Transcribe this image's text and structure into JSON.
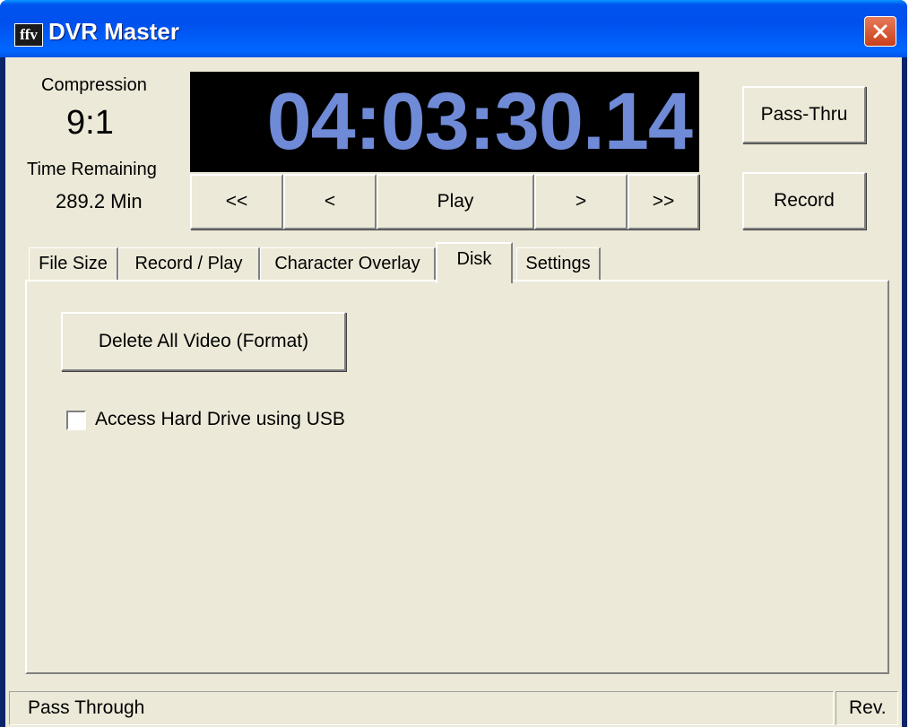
{
  "window": {
    "title": "DVR Master",
    "app_icon_text": "ffv",
    "icons": {
      "app": "app-logo-icon",
      "close": "close-icon"
    },
    "colors": {
      "timecode_text": "#6f8ad6",
      "timecode_bg": "#000000",
      "close_button": "#d9532c"
    }
  },
  "info": {
    "compression_label": "Compression",
    "compression_value": "9:1",
    "time_remaining_label": "Time Remaining",
    "time_remaining_value": "289.2 Min"
  },
  "timecode": "04:03:30.14",
  "transport": {
    "rewind_fast": "<<",
    "rewind": "<",
    "play": "Play",
    "forward": ">",
    "forward_fast": ">>"
  },
  "buttons": {
    "pass_thru": "Pass-Thru",
    "record": "Record"
  },
  "tabs": [
    {
      "label": "File Size",
      "active": false
    },
    {
      "label": "Record / Play",
      "active": false
    },
    {
      "label": "Character Overlay",
      "active": false
    },
    {
      "label": "Disk",
      "active": true
    },
    {
      "label": "Settings",
      "active": false
    }
  ],
  "disk": {
    "format_button": "Delete All Video (Format)",
    "usb_checkbox_label": "Access Hard Drive using USB",
    "usb_checked": false
  },
  "status": {
    "left": "Pass Through",
    "right": "Rev."
  }
}
